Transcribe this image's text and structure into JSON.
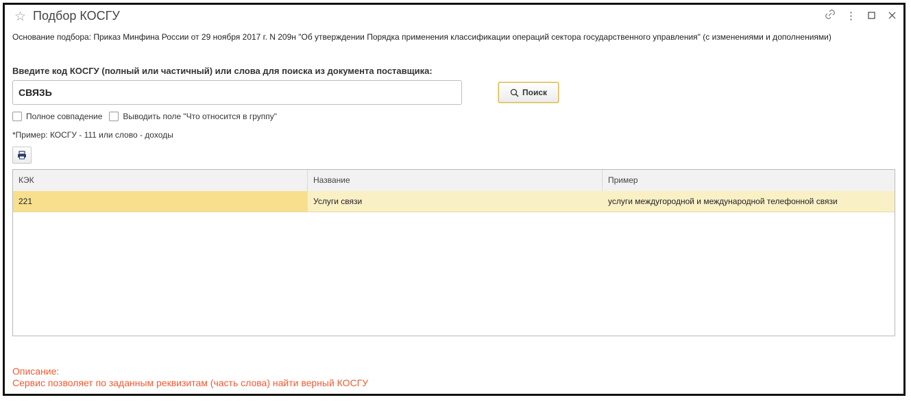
{
  "window": {
    "title": "Подбор КОСГУ",
    "icons": [
      "star-icon",
      "link-icon",
      "more-icon",
      "maximize-icon",
      "close-icon"
    ]
  },
  "basis_text": "Основание подбора: Приказ Минфина России от 29 ноября 2017 г. N 209н \"Об утверждении Порядка применения классификации операций сектора государственного управления\" (с изменениями и дополнениями)",
  "search": {
    "prompt": "Введите код КОСГУ (полный или частичный) или слова для поиска из документа поставщика:",
    "value": "СВЯЗЬ",
    "button_label": "Поиск"
  },
  "options": {
    "full_match_label": "Полное совпадение",
    "show_field_label": "Выводить поле \"Что относится в группу\"",
    "full_match_checked": false,
    "show_field_checked": false
  },
  "example_text": "*Пример: КОСГУ - 111 или слово - доходы",
  "table": {
    "columns": [
      "КЭК",
      "Название",
      "Пример"
    ],
    "rows": [
      {
        "code": "221",
        "name": "Услуги связи",
        "example": "услуги междугородной и международной телефонной связи"
      }
    ]
  },
  "description": {
    "label": "Описание:",
    "text": "Сервис позволяет по заданным реквизитам (часть слова) найти верный КОСГУ"
  },
  "colors": {
    "accent_border": "#d8b85a",
    "selected_row": "#faf0c5",
    "selected_cell": "#f7df8e",
    "description_text": "#f05a32"
  }
}
